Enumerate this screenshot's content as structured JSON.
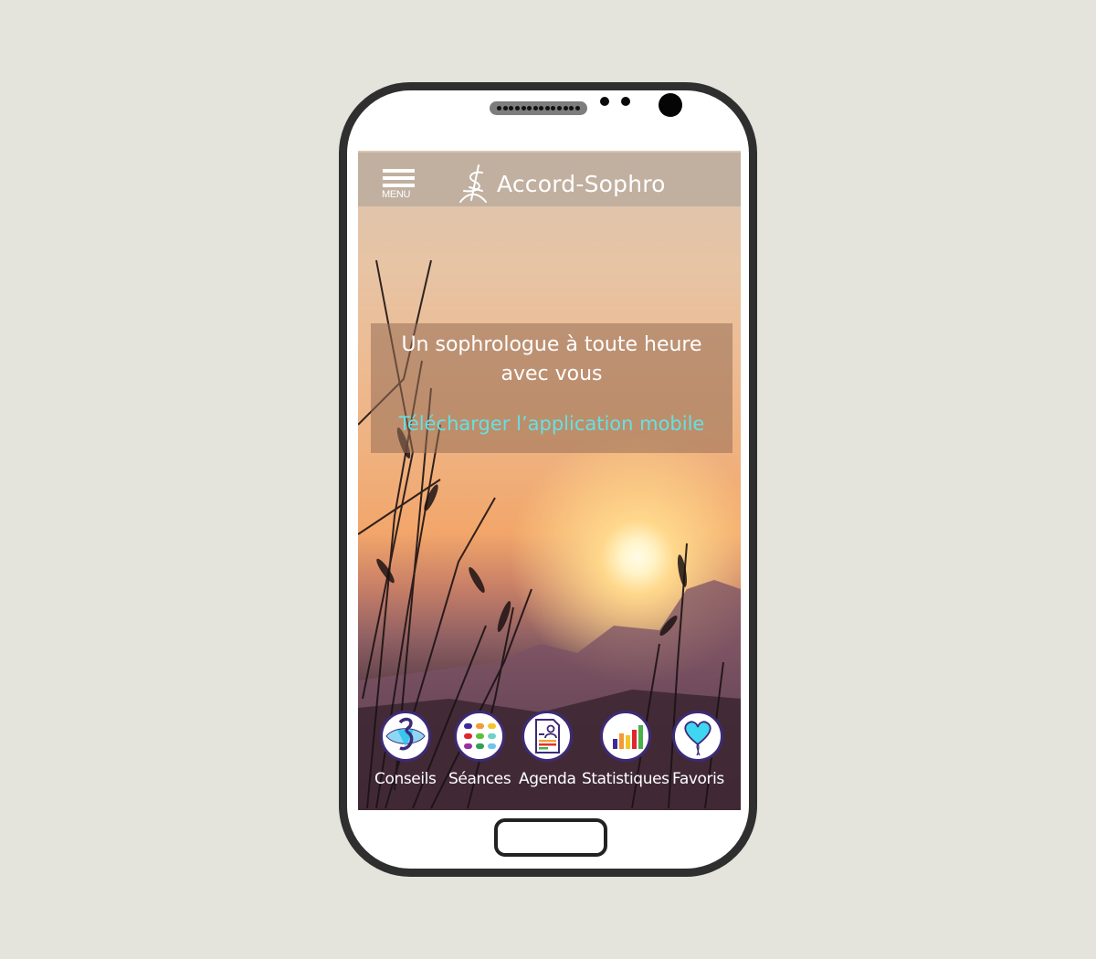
{
  "app": {
    "brand": "Accord-Sophro",
    "menu_label": "MENU"
  },
  "hero": {
    "tagline": "Un sophrologue à toute heure avec vous",
    "download_link": "Télécharger l’application mobile",
    "link_color": "#66e0e2"
  },
  "bottom_nav": {
    "items": [
      {
        "label": "Conseils",
        "icon": "third-eye-icon"
      },
      {
        "label": "Séances",
        "icon": "grid-dots-icon"
      },
      {
        "label": "Agenda",
        "icon": "profile-document-icon"
      },
      {
        "label": "Statistiques",
        "icon": "bar-chart-icon"
      },
      {
        "label": "Favoris",
        "icon": "heart-balloon-icon"
      }
    ],
    "ring_color": "#3d2a78"
  },
  "device": {
    "frame_color": "#2f2f2f",
    "background_color": "#e4e3dc"
  }
}
